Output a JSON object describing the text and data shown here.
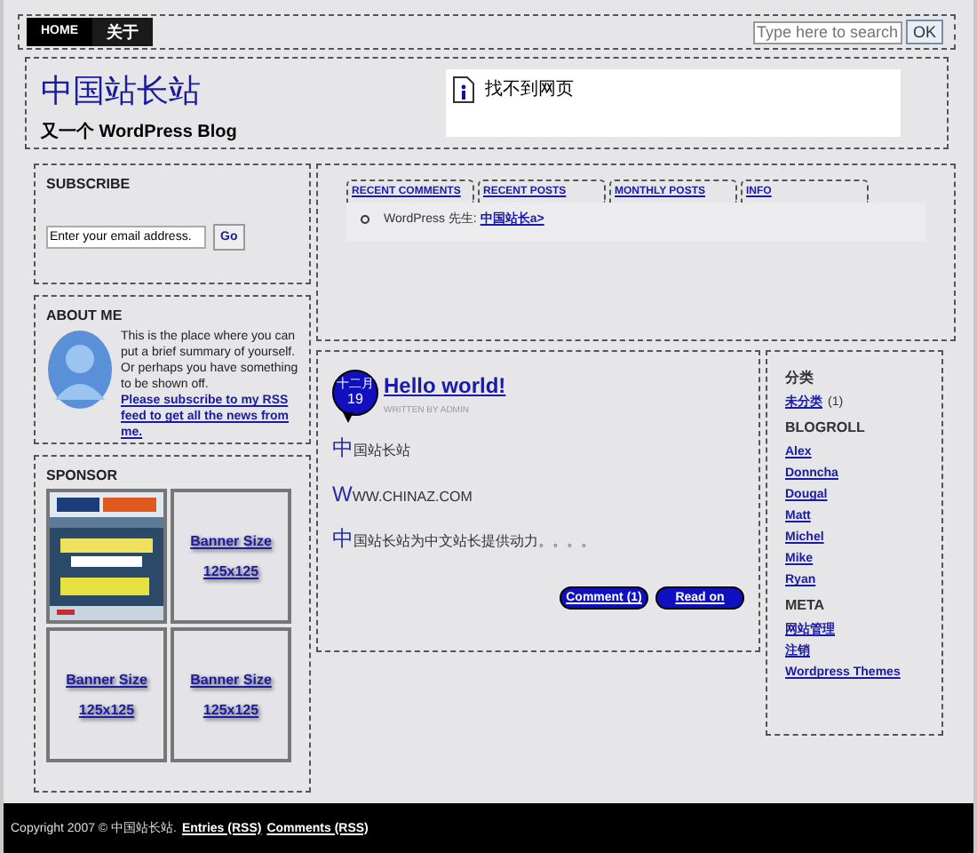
{
  "nav": [
    {
      "label": "HOME",
      "selected": true
    },
    {
      "label": "关于",
      "selected": false
    }
  ],
  "search": {
    "placeholder": "Type here to search",
    "button": "OK"
  },
  "header": {
    "title": "中国站长站",
    "tagline": "又一个 WordPress Blog",
    "notice": "找不到网页"
  },
  "subscribe": {
    "title": "SUBSCRIBE",
    "value": "Enter your email address.",
    "button": "Go"
  },
  "about": {
    "title": "ABOUT ME",
    "text": "This is the place where you can put a brief summary of yourself. Or perhaps you have something to be shown off. ",
    "link": "Please subscribe to my RSS feed to get all the news from me."
  },
  "sponsor": {
    "title": "SPONSOR",
    "banners": [
      {
        "kind": "picture"
      },
      {
        "kind": "text",
        "line_1": "Banner Size",
        "line_2": "125x125"
      },
      {
        "kind": "text",
        "line_1": "Banner Size",
        "line_2": "125x125"
      },
      {
        "kind": "text",
        "line_1": "Banner Size",
        "line_2": "125x125"
      }
    ]
  },
  "widget": {
    "tabs": [
      "RECENT COMMENTS",
      "RECENT POSTS",
      "MONTHLY POSTS",
      "INFO"
    ],
    "items": [
      {
        "text": "WordPress 先生: ",
        "link": "中国站长a>"
      }
    ]
  },
  "post": {
    "month": "十二月",
    "day": "19",
    "title": "Hello world!",
    "byline": "WRITTEN BY ADMIN",
    "paragraphs": [
      "中国站长站",
      "WWW.CHINAZ.COM",
      "中国站长站为中文站长提供动力。。。。"
    ],
    "buttons": [
      "Comment (1)",
      "Read on"
    ]
  },
  "sidebar": [
    {
      "title": "分类",
      "links": [
        {
          "label": "未分类",
          "count": "(1)"
        }
      ]
    },
    {
      "title": "BLOGROLL",
      "links": [
        {
          "label": "Alex"
        },
        {
          "label": "Donncha"
        },
        {
          "label": "Dougal"
        },
        {
          "label": "Matt"
        },
        {
          "label": "Michel"
        },
        {
          "label": "Mike"
        },
        {
          "label": "Ryan"
        }
      ]
    },
    {
      "title": "META",
      "links": [
        {
          "label": "网站管理"
        },
        {
          "label": "注销"
        },
        {
          "label": "Wordpress Themes"
        }
      ]
    }
  ],
  "footer": {
    "text": "Copyright 2007 © 中国站长站. ",
    "links": [
      "Entries (RSS)",
      "Comments (RSS)"
    ]
  }
}
